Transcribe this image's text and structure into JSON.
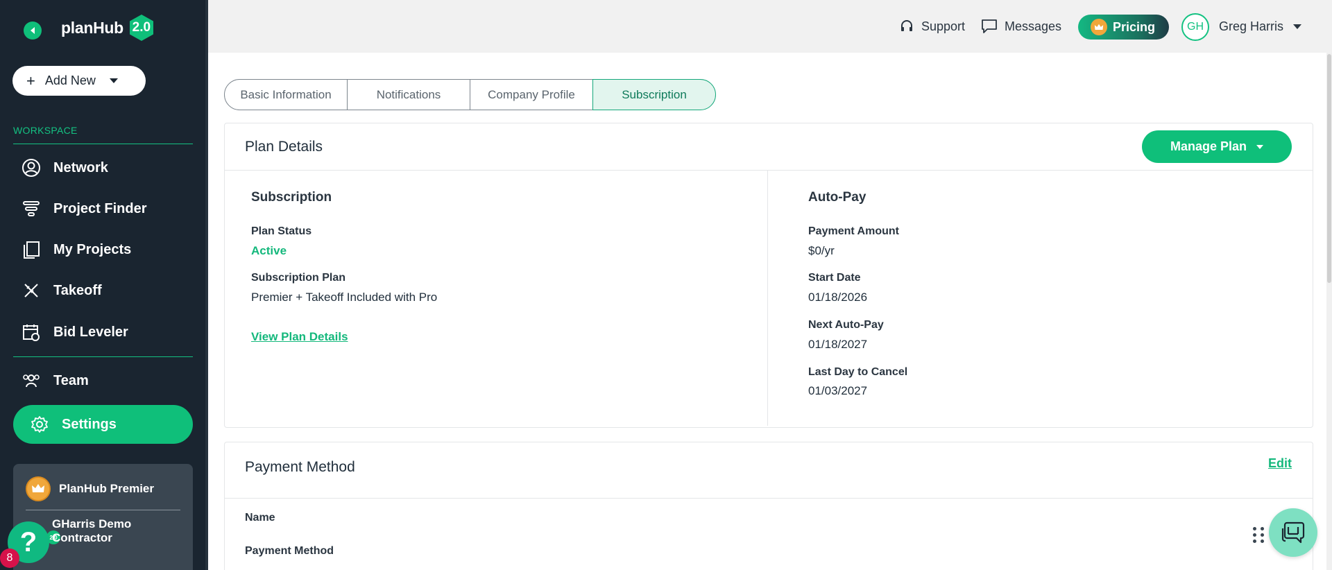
{
  "app": {
    "logo_text": "planHub",
    "logo_version": "2.0"
  },
  "sidebar": {
    "add_new_label": "Add New",
    "section_label": "WORKSPACE",
    "items": [
      {
        "label": "Network",
        "icon": "user-circle-icon"
      },
      {
        "label": "Project Finder",
        "icon": "filter-stack-icon"
      },
      {
        "label": "My Projects",
        "icon": "documents-icon"
      },
      {
        "label": "Takeoff",
        "icon": "ruler-pencil-icon"
      },
      {
        "label": "Bid Leveler",
        "icon": "calendar-icon"
      },
      {
        "label": "Team",
        "icon": "team-icon"
      },
      {
        "label": "Settings",
        "icon": "gear-icon"
      }
    ],
    "premium": {
      "title": "PlanHub Premier",
      "company": "GHarris Demo Contractor",
      "company_badge": "2.0"
    },
    "help_label": "?",
    "notification_count": "8"
  },
  "topbar": {
    "support_label": "Support",
    "messages_label": "Messages",
    "pricing_label": "Pricing",
    "avatar_initials": "GH",
    "user_name": "Greg Harris"
  },
  "tabs": [
    {
      "label": "Basic Information",
      "active": false
    },
    {
      "label": "Notifications",
      "active": false
    },
    {
      "label": "Company Profile",
      "active": false
    },
    {
      "label": "Subscription",
      "active": true
    }
  ],
  "plan_details": {
    "title": "Plan Details",
    "manage_plan_label": "Manage Plan",
    "subscription": {
      "heading": "Subscription",
      "plan_status_label": "Plan Status",
      "plan_status_value": "Active",
      "subscription_plan_label": "Subscription Plan",
      "subscription_plan_value": "Premier + Takeoff Included with Pro",
      "view_details_link": "View Plan Details"
    },
    "autopay": {
      "heading": "Auto-Pay",
      "payment_amount_label": "Payment Amount",
      "payment_amount_value": "$0/yr",
      "start_date_label": "Start Date",
      "start_date_value": "01/18/2026",
      "next_autopay_label": "Next Auto-Pay",
      "next_autopay_value": "01/18/2027",
      "last_day_label": "Last Day to Cancel",
      "last_day_value": "01/03/2027"
    }
  },
  "payment_method": {
    "title": "Payment Method",
    "edit_label": "Edit",
    "name_label": "Name",
    "method_label": "Payment Method"
  },
  "colors": {
    "accent": "#0fbf7a",
    "sidebar_bg": "#1a2530",
    "link": "#14b87c"
  }
}
